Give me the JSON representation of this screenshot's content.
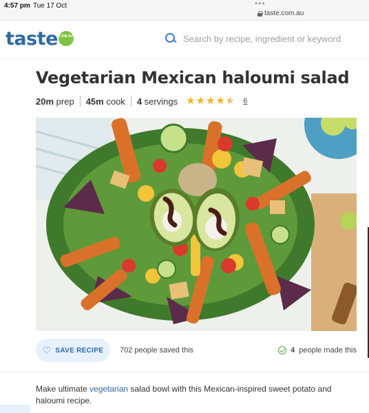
{
  "status_bar": {
    "time": "4:57 pm",
    "date": "Tue 17 Oct",
    "url": "taste.com.au",
    "menu_dots": "•••"
  },
  "header": {
    "logo_text": "taste",
    "logo_badge": "COM AU",
    "search_placeholder": "Search by recipe, ingredient or keyword"
  },
  "recipe": {
    "title": "Vegetarian Mexican haloumi salad",
    "prep_value": "20m",
    "prep_label": "prep",
    "cook_value": "45m",
    "cook_label": "cook",
    "servings_value": "4",
    "servings_label": "servings",
    "rating": 4.5,
    "rating_max": 5,
    "rating_count": "6"
  },
  "actions": {
    "save_label": "SAVE RECIPE",
    "saved_count_text": "702 people saved this",
    "made_count": "4",
    "made_label": "people made this"
  },
  "description": {
    "lead": "Make ultimate ",
    "link_text": "vegetarian",
    "rest": " salad bowl with this Mexican-inspired sweet potato and haloumi recipe."
  },
  "colors": {
    "brand_blue": "#2d6aa5",
    "link_blue": "#3c7bd6",
    "badge_green": "#7fc242",
    "star_gold": "#f2b41b"
  }
}
